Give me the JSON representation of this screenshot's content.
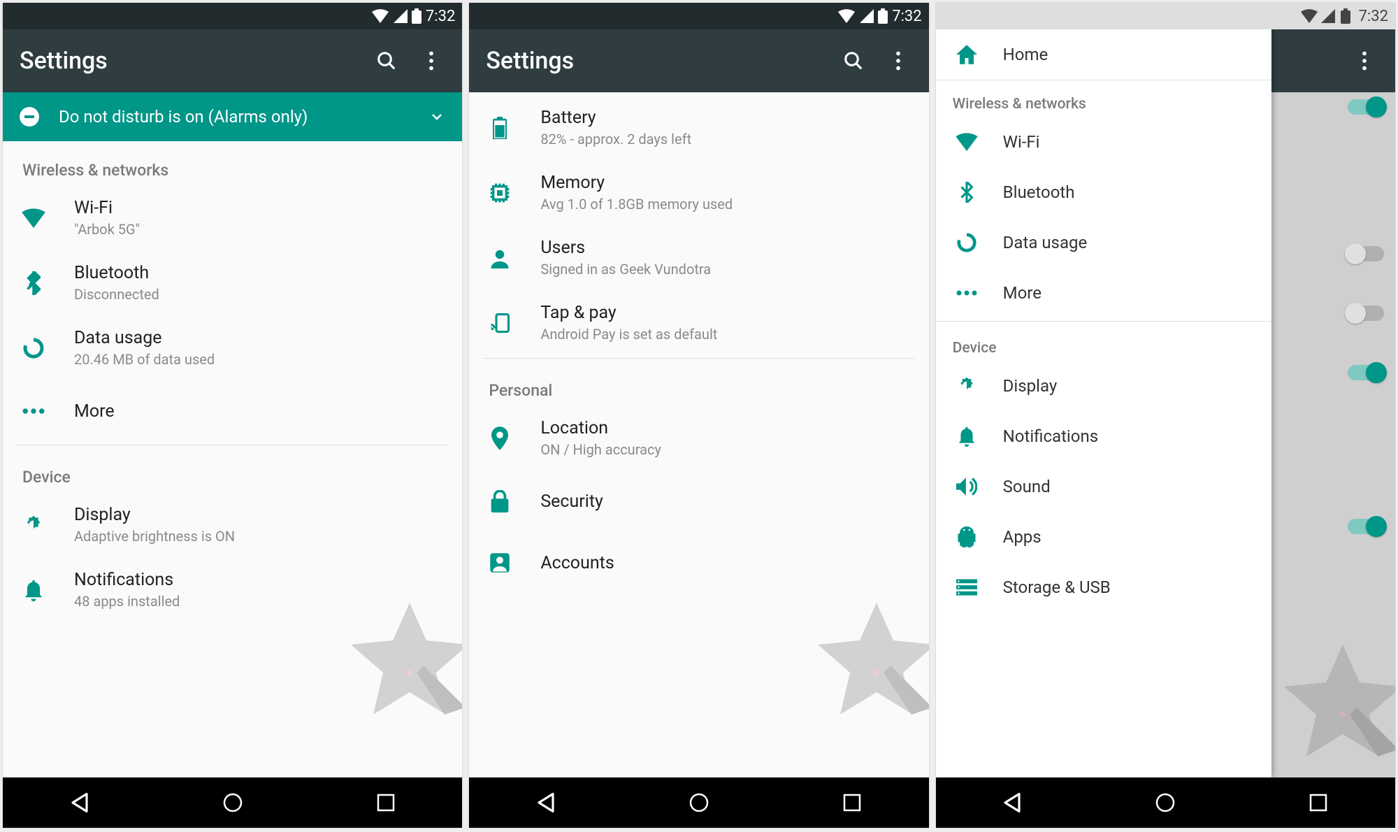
{
  "status": {
    "time": "7:32"
  },
  "appbar": {
    "title": "Settings"
  },
  "banner": {
    "text": "Do not disturb is on (Alarms only)"
  },
  "p1": {
    "sec_wireless": "Wireless & networks",
    "wifi": {
      "title": "Wi-Fi",
      "sub": "\"Arbok 5G\""
    },
    "bt": {
      "title": "Bluetooth",
      "sub": "Disconnected"
    },
    "data": {
      "title": "Data usage",
      "sub": "20.46 MB of data used"
    },
    "more": {
      "title": "More"
    },
    "sec_device": "Device",
    "display": {
      "title": "Display",
      "sub": "Adaptive brightness is ON"
    },
    "notif": {
      "title": "Notifications",
      "sub": "48 apps installed"
    }
  },
  "p2": {
    "battery": {
      "title": "Battery",
      "sub": "82% - approx. 2 days left"
    },
    "memory": {
      "title": "Memory",
      "sub": "Avg 1.0 of 1.8GB memory used"
    },
    "users": {
      "title": "Users",
      "sub": "Signed in as Geek Vundotra"
    },
    "tap": {
      "title": "Tap & pay",
      "sub": "Android Pay is set as default"
    },
    "sec_personal": "Personal",
    "location": {
      "title": "Location",
      "sub": "ON / High accuracy"
    },
    "security": {
      "title": "Security"
    },
    "accounts": {
      "title": "Accounts"
    }
  },
  "p3": {
    "home": "Home",
    "sec_wireless": "Wireless & networks",
    "wifi": "Wi-Fi",
    "bt": "Bluetooth",
    "data": "Data usage",
    "more": "More",
    "sec_device": "Device",
    "display": "Display",
    "notif": "Notifications",
    "sound": "Sound",
    "apps": "Apps",
    "storage": "Storage & USB"
  }
}
